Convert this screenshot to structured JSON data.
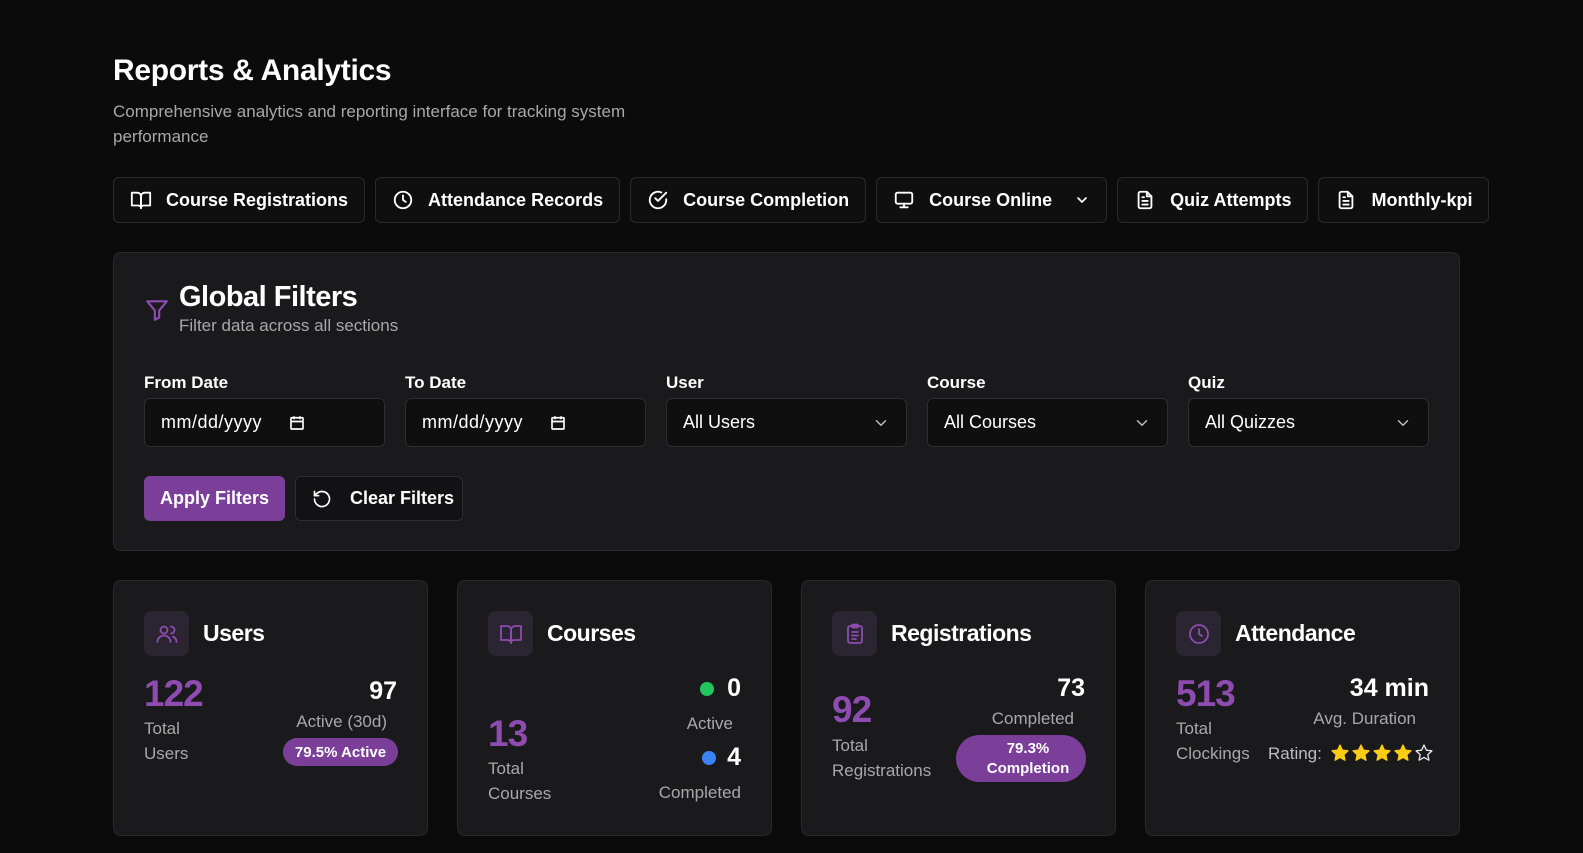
{
  "header": {
    "title": "Reports & Analytics",
    "subtitle": "Comprehensive analytics and reporting interface for tracking system performance"
  },
  "tabs": [
    {
      "label": "Course Registrations",
      "icon": "book-icon"
    },
    {
      "label": "Attendance Records",
      "icon": "clock-icon"
    },
    {
      "label": "Course Completion",
      "icon": "check-circle-icon"
    },
    {
      "label": "Course Online",
      "icon": "monitor-icon",
      "dropdown": true
    },
    {
      "label": "Quiz Attempts",
      "icon": "document-icon"
    },
    {
      "label": "Monthly-kpi",
      "icon": "document-icon"
    }
  ],
  "filters": {
    "title": "Global Filters",
    "subtitle": "Filter data across all sections",
    "from_date": {
      "label": "From Date",
      "placeholder": "mm/dd/yyyy"
    },
    "to_date": {
      "label": "To Date",
      "placeholder": "mm/dd/yyyy"
    },
    "user": {
      "label": "User",
      "value": "All Users"
    },
    "course": {
      "label": "Course",
      "value": "All Courses"
    },
    "quiz": {
      "label": "Quiz",
      "value": "All Quizzes"
    },
    "apply_label": "Apply Filters",
    "clear_label": "Clear Filters"
  },
  "cards": {
    "users": {
      "title": "Users",
      "total": "122",
      "total_label_1": "Total",
      "total_label_2": "Users",
      "active": "97",
      "active_label": "Active (30d)",
      "badge": "79.5% Active"
    },
    "courses": {
      "title": "Courses",
      "total": "13",
      "total_label_1": "Total",
      "total_label_2": "Courses",
      "active": "0",
      "active_label": "Active",
      "completed": "4",
      "completed_label": "Completed"
    },
    "registrations": {
      "title": "Registrations",
      "total": "92",
      "total_label_1": "Total",
      "total_label_2": "Registrations",
      "completed": "73",
      "completed_label": "Completed",
      "badge_1": "79.3%",
      "badge_2": "Completion"
    },
    "attendance": {
      "title": "Attendance",
      "total": "513",
      "total_label_1": "Total",
      "total_label_2": "Clockings",
      "avg": "34 min",
      "avg_label": "Avg. Duration",
      "rating_label": "Rating:",
      "rating_value": 4,
      "rating_max": 5
    }
  },
  "colors": {
    "accent": "#7b3f9a",
    "accent_text": "#8e4bb0",
    "active_dot": "#22c55e",
    "completed_dot": "#3b82f6",
    "star": "#facc15"
  }
}
